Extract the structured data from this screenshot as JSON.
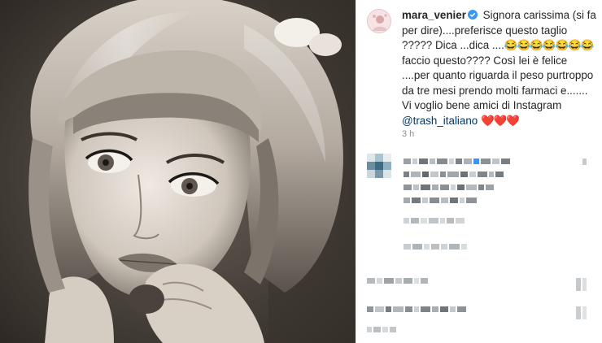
{
  "post": {
    "username": "mara_venier",
    "caption_line_1": "Signora carissima (si fa",
    "caption_line_2": "per dire)....preferisce questo taglio",
    "caption_line_3": "????? Dica ...dica ....",
    "caption_line_3_emoji": "😂😂😂😂😂😂😂",
    "caption_line_4": "faccio questo???? Così lei è felice",
    "caption_line_5": "....per quanto riguarda il peso",
    "caption_line_6": "purtroppo da tre mesi prendo molti",
    "caption_line_7": "farmaci e....... Vi voglio bene amici di",
    "caption_line_8_prefix": "Instagram ",
    "mention": "@trash_italiano",
    "hearts": "❤️❤️❤️",
    "timestamp": "3 h"
  },
  "icons": {
    "verified": "verified-badge-icon",
    "avatar": "profile-avatar"
  },
  "colors": {
    "verified": "#3897f0",
    "mention": "#00376b",
    "timestamp": "#8e8e8e"
  }
}
